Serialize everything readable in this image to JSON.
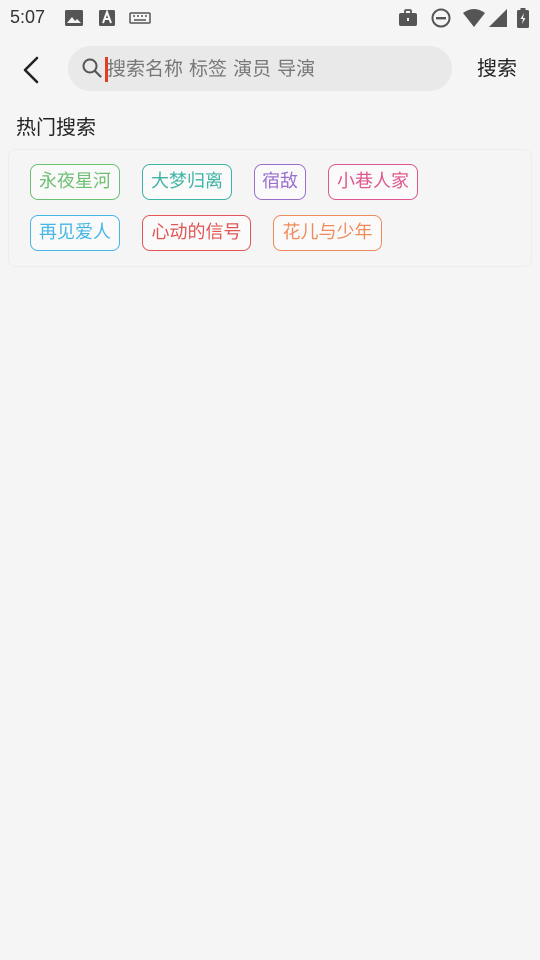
{
  "status_bar": {
    "time": "5:07",
    "icons": [
      "image-icon",
      "text-a-icon",
      "keyboard-icon",
      "briefcase-icon",
      "do-not-disturb-icon",
      "wifi-icon",
      "signal-icon",
      "battery-icon"
    ]
  },
  "search": {
    "placeholder": "搜索名称 标签 演员 导演",
    "value": "",
    "button_label": "搜索"
  },
  "hot_search": {
    "title": "热门搜索",
    "tags": [
      {
        "label": "永夜星河",
        "color": "#6dbf72"
      },
      {
        "label": "大梦归离",
        "color": "#3fb3a4"
      },
      {
        "label": "宿敌",
        "color": "#9a6fd0"
      },
      {
        "label": "小巷人家",
        "color": "#e0578f"
      },
      {
        "label": "再见爱人",
        "color": "#46b6e6"
      },
      {
        "label": "心动的信号",
        "color": "#e25555"
      },
      {
        "label": "花儿与少年",
        "color": "#ef8a5b"
      }
    ]
  }
}
